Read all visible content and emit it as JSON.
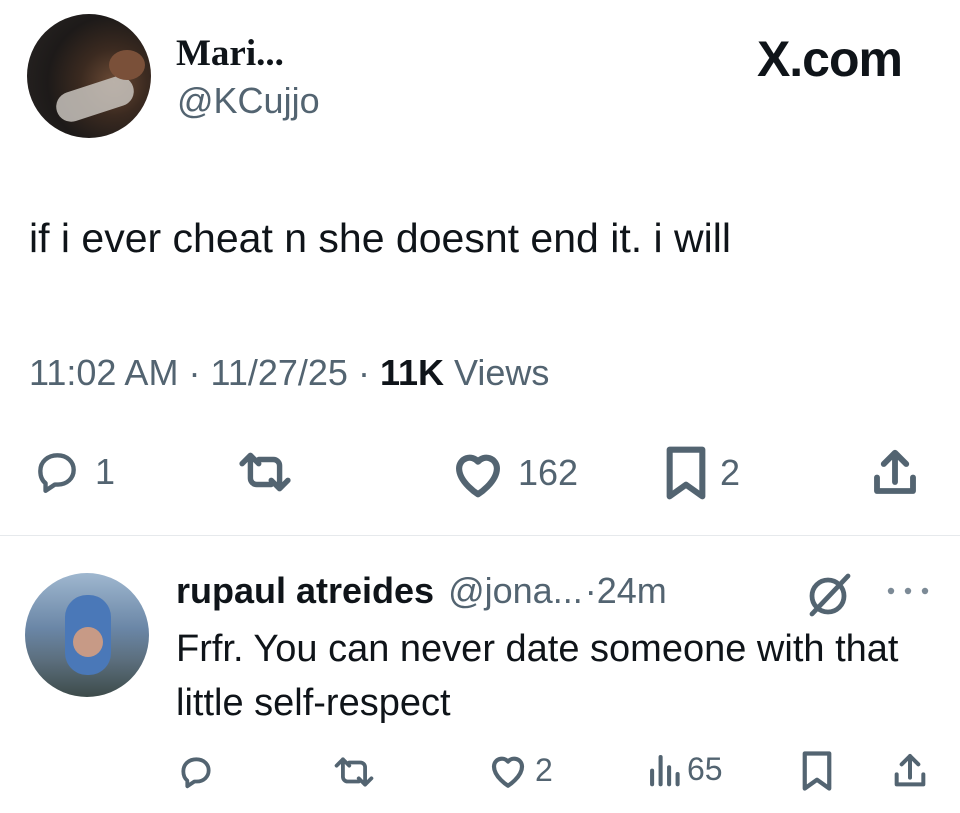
{
  "brand": "X.com",
  "tweet": {
    "author_name": "Mari...",
    "author_handle": "@KCujjo",
    "text": "if i ever cheat n she doesnt end it. i will",
    "time": "11:02 AM",
    "date": "11/27/25",
    "views_count": "11K",
    "views_label": "Views",
    "separator": "·",
    "actions": {
      "replies": "1",
      "likes": "162",
      "bookmarks": "2"
    }
  },
  "reply": {
    "author_name": "rupaul atreides",
    "author_handle": "@jona...",
    "time": "·24m",
    "text": "Frfr. You can never date someone with that little self-respect",
    "actions": {
      "likes": "2",
      "views": "65"
    }
  },
  "colors": {
    "text": "#0f1419",
    "secondary": "#536471",
    "divider": "#e6e9ec"
  }
}
